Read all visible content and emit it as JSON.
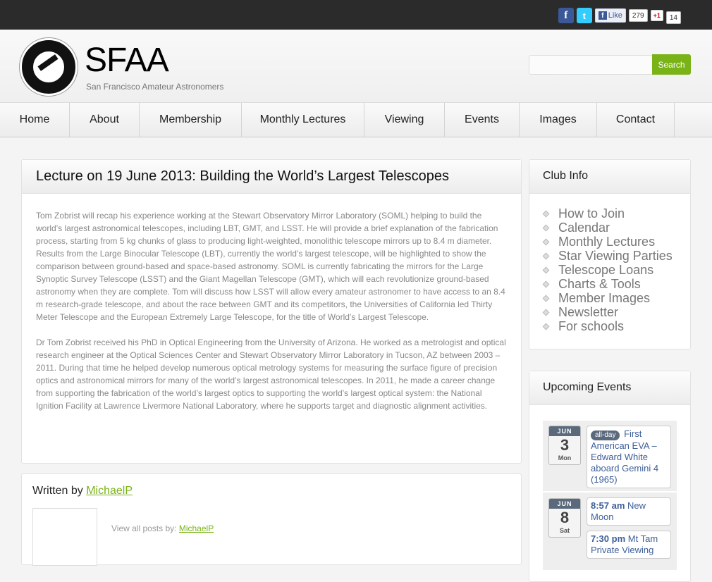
{
  "social": {
    "like_label": "Like",
    "like_count": "279",
    "gplus_label": "+1",
    "gplus_count": "14"
  },
  "site": {
    "title": "SFAA",
    "tagline": "San Francisco Amateur Astronomers"
  },
  "search": {
    "button_label": "Search",
    "placeholder": ""
  },
  "nav": {
    "items": [
      {
        "label": "Home"
      },
      {
        "label": "About"
      },
      {
        "label": "Membership"
      },
      {
        "label": "Monthly Lectures"
      },
      {
        "label": "Viewing"
      },
      {
        "label": "Events"
      },
      {
        "label": "Images"
      },
      {
        "label": "Contact"
      }
    ]
  },
  "post": {
    "title": "Lecture on 19 June 2013: Building the World’s Largest Telescopes",
    "paragraphs": [
      "Tom Zobrist will recap his experience working at the Stewart Observatory Mirror Laboratory (SOML) helping to build the world’s largest astronomical telescopes, including LBT, GMT, and LSST. He will provide a brief explanation of the fabrication process, starting from 5 kg chunks of glass to producing light-weighted, monolithic telescope mirrors up to 8.4 m diameter. Results from the Large Binocular Telescope (LBT), currently the world’s largest telescope, will be highlighted to show the comparison between ground-based and space-based astronomy. SOML is currently fabricating the mirrors for the Large Synoptic Survey Telescope (LSST) and the Giant Magellan Telescope (GMT), which will each revolutionize ground-based astronomy when they are complete. Tom will discuss how LSST will allow every amateur astronomer to have access to an 8.4 m research-grade telescope, and about the race between GMT and its competitors, the Universities of California led Thirty Meter Telescope and the European Extremely Large Telescope, for the title of World’s Largest Telescope.",
      "Dr Tom Zobrist received his PhD in Optical Engineering from the University of Arizona. He worked as a metrologist and optical research engineer at the Optical Sciences Center and Stewart Observatory Mirror Laboratory in Tucson, AZ between 2003 – 2011. During that time he helped develop numerous optical metrology systems for measuring the surface figure of precision optics and astronomical mirrors for many of the world’s largest astronomical telescopes. In 2011, he made a career change from supporting the fabrication of the world’s largest optics to supporting the world’s largest optical system: the National Ignition Facility at Lawrence Livermore National Laboratory, where he supports target and diagnostic alignment activities."
    ]
  },
  "author": {
    "written_by": "Written by",
    "name": "MichaelP",
    "view_all": "View all posts by:",
    "view_link": "MichaelP"
  },
  "club_info": {
    "title": "Club Info",
    "items": [
      {
        "label": "How to Join"
      },
      {
        "label": "Calendar"
      },
      {
        "label": "Monthly Lectures"
      },
      {
        "label": "Star Viewing Parties"
      },
      {
        "label": "Telescope Loans"
      },
      {
        "label": "Charts & Tools"
      },
      {
        "label": "Member Images"
      },
      {
        "label": "Newsletter"
      },
      {
        "label": "For schools"
      }
    ]
  },
  "upcoming": {
    "title": "Upcoming Events",
    "events": [
      {
        "month": "JUN",
        "day": "3",
        "dow": "Mon",
        "badge": "all-day",
        "text": "First American EVA – Edward White aboard Gemini 4 (1965)"
      },
      {
        "month": "JUN",
        "day": "8",
        "dow": "Sat",
        "time": "8:57 am",
        "text": "New Moon",
        "time2": "7:30 pm",
        "text2": "Mt Tam Private Viewing"
      }
    ]
  }
}
